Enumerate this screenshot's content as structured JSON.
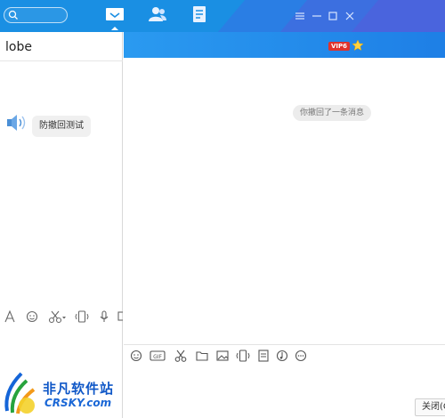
{
  "conversation": {
    "name": "lobe"
  },
  "left_chat": {
    "message": "防撤回测试"
  },
  "right_chat": {
    "vip_label": "VIP6",
    "system_message": "你撤回了一条消息"
  },
  "buttons": {
    "close_label": "关闭(C"
  },
  "watermark": {
    "cn_text": "非凡软件站",
    "en_text": "CRSKY.com"
  },
  "colors": {
    "titlebar": "#1a8fe3",
    "strip": "#1e7fe6",
    "vip": "#e0322b",
    "watermark": "#0f57c7"
  },
  "icons": {
    "topbar": [
      "search-icon",
      "chat-icon",
      "contacts-icon",
      "document-icon",
      "menu-icon",
      "minimize-icon",
      "maximize-icon",
      "close-icon"
    ],
    "left_toolbar": [
      "font-icon",
      "emoji-icon",
      "scissors-icon",
      "vibrate-icon",
      "microphone-icon"
    ],
    "right_toolbar": [
      "emoji-icon",
      "gif-icon",
      "scissors-icon",
      "folder-icon",
      "image-icon",
      "vibrate-icon",
      "file-icon",
      "music-icon",
      "more-icon"
    ]
  }
}
